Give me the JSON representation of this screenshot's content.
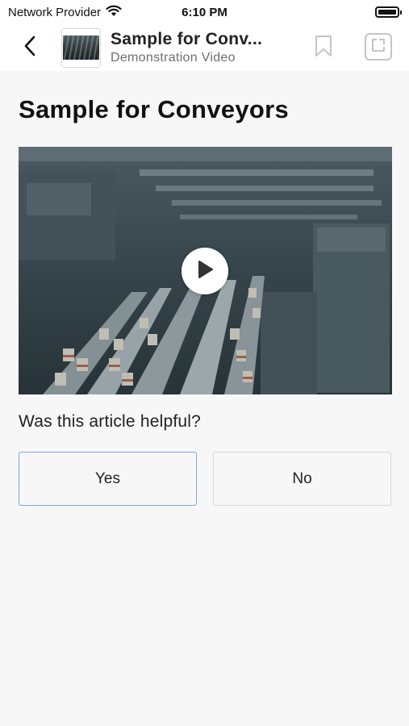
{
  "status_bar": {
    "carrier": "Network Provider",
    "time": "6:10 PM"
  },
  "header": {
    "title": "Sample for Conv...",
    "subtitle": "Demonstration Video"
  },
  "article": {
    "title": "Sample for Conveyors"
  },
  "feedback": {
    "question": "Was this article helpful?",
    "yes_label": "Yes",
    "no_label": "No"
  },
  "colors": {
    "yes_border": "#7ba6e6",
    "background": "#f7f7f7"
  },
  "icons": [
    "wifi-icon",
    "battery-icon",
    "back-chevron-icon",
    "bookmark-icon",
    "share-icon",
    "play-icon"
  ]
}
